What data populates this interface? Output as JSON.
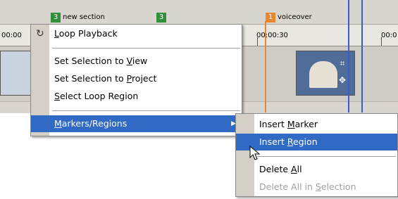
{
  "markers": [
    {
      "num": "3",
      "label": "new section"
    },
    {
      "num": "3",
      "label": ""
    },
    {
      "num": "1",
      "label": "voiceover"
    }
  ],
  "ruler": {
    "left_label": "00:00",
    "mid_label": "00:00:30",
    "right_label": "00:0"
  },
  "context_menu": {
    "loop_playback": {
      "pre": "",
      "key": "L",
      "post": "oop Playback"
    },
    "set_selection_view": {
      "pre": "Set Selection to ",
      "key": "V",
      "post": "iew"
    },
    "set_selection_project": {
      "pre": "Set Selection to ",
      "key": "P",
      "post": "roject"
    },
    "select_loop_region": {
      "pre": "",
      "key": "S",
      "post": "elect Loop Region"
    },
    "markers_regions": {
      "pre": "",
      "key": "M",
      "post": "arkers/Regions"
    }
  },
  "submenu": {
    "insert_marker": {
      "pre": "Insert ",
      "key": "M",
      "post": "arker"
    },
    "insert_region": {
      "pre": "Insert ",
      "key": "R",
      "post": "egion"
    },
    "delete_all": {
      "pre": "Delete ",
      "key": "A",
      "post": "ll"
    },
    "delete_all_selection": {
      "pre": "Delete All in ",
      "key": "S",
      "post": "election"
    }
  },
  "colors": {
    "highlight": "#316ac5",
    "marker_green": "#2f8f3a",
    "marker_orange": "#e8872e",
    "playhead_blue": "#3a5ccc"
  },
  "icons": [
    "loop-icon",
    "submenu-arrow-icon",
    "mouse-cursor-icon",
    "crop-icon",
    "pan-icon"
  ]
}
